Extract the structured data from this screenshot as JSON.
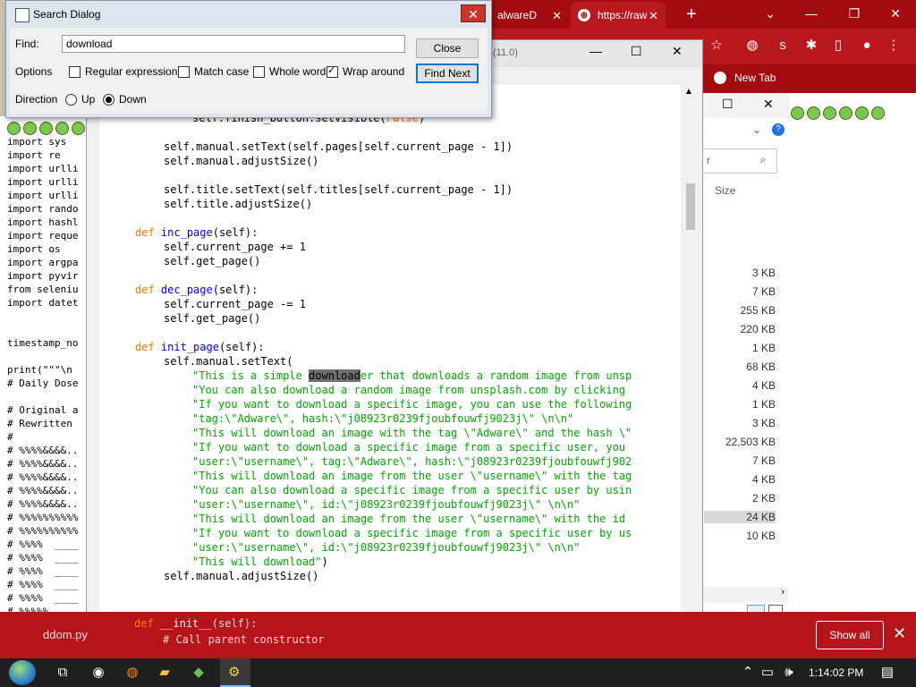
{
  "chrome": {
    "tab1_label": "alwareD",
    "tab2_label": "https://raw",
    "new_tab_label": "New Tab",
    "accent": "#a30b10"
  },
  "explorer": {
    "search_placeholder": "r",
    "size_header": "Size",
    "sizes": [
      "3 KB",
      "7 KB",
      "255 KB",
      "220 KB",
      "1 KB",
      "68 KB",
      "4 KB",
      "1 KB",
      "3 KB",
      "22,503 KB",
      "7 KB",
      "4 KB",
      "2 KB",
      "24 KB",
      "10 KB"
    ]
  },
  "notification": {
    "file_name": "ddom.py",
    "show_all": "Show all",
    "accent": "#b4141a"
  },
  "left_code": [
    "import sys",
    "import re",
    "import urlli",
    "import urlli",
    "import urlli",
    "import rando",
    "import hashl",
    "import reque",
    "import os",
    "import argpa",
    "import pyvir",
    "from seleniu",
    "import datet",
    "",
    "",
    "timestamp_no",
    "",
    "print(\"\"\"\\n",
    "# Daily Dose",
    "",
    "# Original a",
    "# Rewritten",
    "#",
    "# %%%%&&&&..",
    "# %%%%&&&&..",
    "# %%%%&&&&..",
    "# %%%%&&&&..",
    "# %%%%&&&&..",
    "# %%%%%%%%%%",
    "# %%%%%%%%%%",
    "# %%%%  ____",
    "# %%%%  ____",
    "# %%%%  ____",
    "# %%%%  ____",
    "# %%%%  ____",
    "# %%%%%"
  ],
  "editor": {
    "title": "(11.0)",
    "search_term": "download"
  },
  "dialog": {
    "title": "Search Dialog",
    "find_label": "Find:",
    "find_value": "download",
    "close_label": "Close",
    "find_next_label": "Find Next",
    "options_label": "Options",
    "opt_regex": "Regular expression",
    "opt_case": "Match case",
    "opt_word": "Whole word",
    "opt_wrap": "Wrap around",
    "direction_label": "Direction",
    "dir_up": "Up",
    "dir_down": "Down"
  },
  "taskbar": {
    "time": "1:14:02 PM"
  }
}
